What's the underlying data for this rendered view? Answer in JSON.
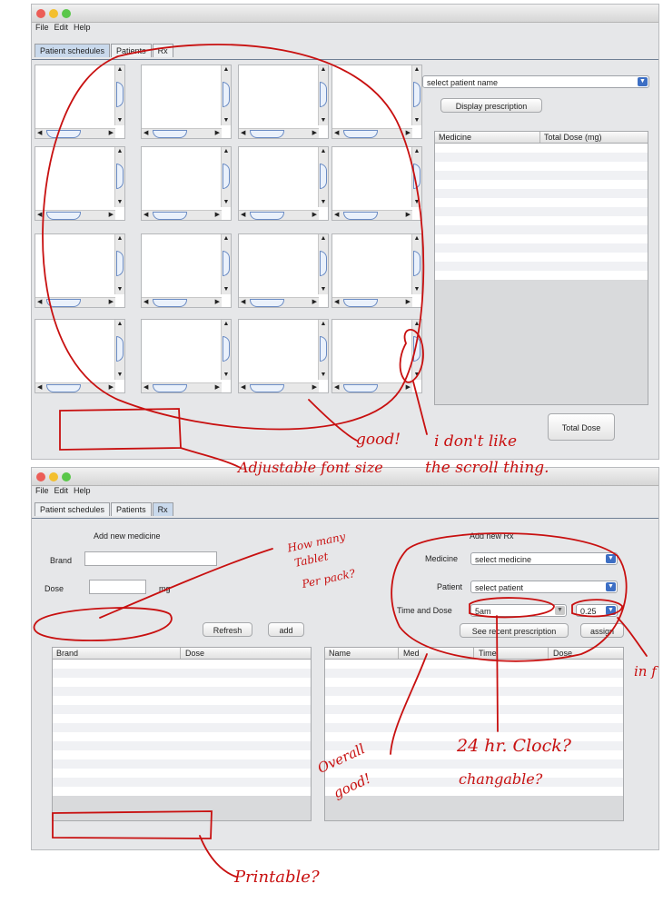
{
  "window1": {
    "menu": [
      "File",
      "Edit",
      "Help"
    ],
    "tabs": [
      "Patient schedules",
      "Patients",
      "Rx"
    ],
    "patient_select": "select patient name",
    "display_button": "Display prescription",
    "table_columns": [
      "Medicine",
      "Total Dose (mg)"
    ],
    "total_dose_button": "Total Dose"
  },
  "window2": {
    "menu": [
      "File",
      "Edit",
      "Help"
    ],
    "tabs": [
      "Patient schedules",
      "Patients",
      "Rx"
    ],
    "add_medicine_title": "Add new medicine",
    "brand_label": "Brand",
    "dose_label": "Dose",
    "mg_label": "mg",
    "refresh_button": "Refresh",
    "add_button": "add",
    "add_rx_title": "Add new Rx",
    "medicine_label": "Medicine",
    "medicine_select": "select medicine",
    "patient_label": "Patient",
    "patient_select": "select patient",
    "time_dose_label": "Time and Dose",
    "time_value": "5am",
    "dose_value": "0.25",
    "see_recent_button": "See recent prescription",
    "assign_button": "assign",
    "left_table_columns": [
      "Brand",
      "Dose"
    ],
    "right_table_columns": [
      "Name",
      "Med",
      "Time",
      "Dose"
    ]
  },
  "annotations": {
    "good": "good!",
    "dont_like": "i don't like",
    "scroll_thing": "the scroll thing.",
    "adjustable": "Adjustable font size",
    "how_many": "How many",
    "tablet": "Tablet",
    "per_pack": "Per pack?",
    "overall": "Overall",
    "overall_good": "good!",
    "clock": "24 hr. Clock?",
    "changeable": "changable?",
    "in_f": "in f",
    "printable": "Printable?"
  },
  "colors": {
    "ink": "#c81010",
    "selected_tab": "#c9d9ec",
    "accent": "#3d6fc4"
  }
}
